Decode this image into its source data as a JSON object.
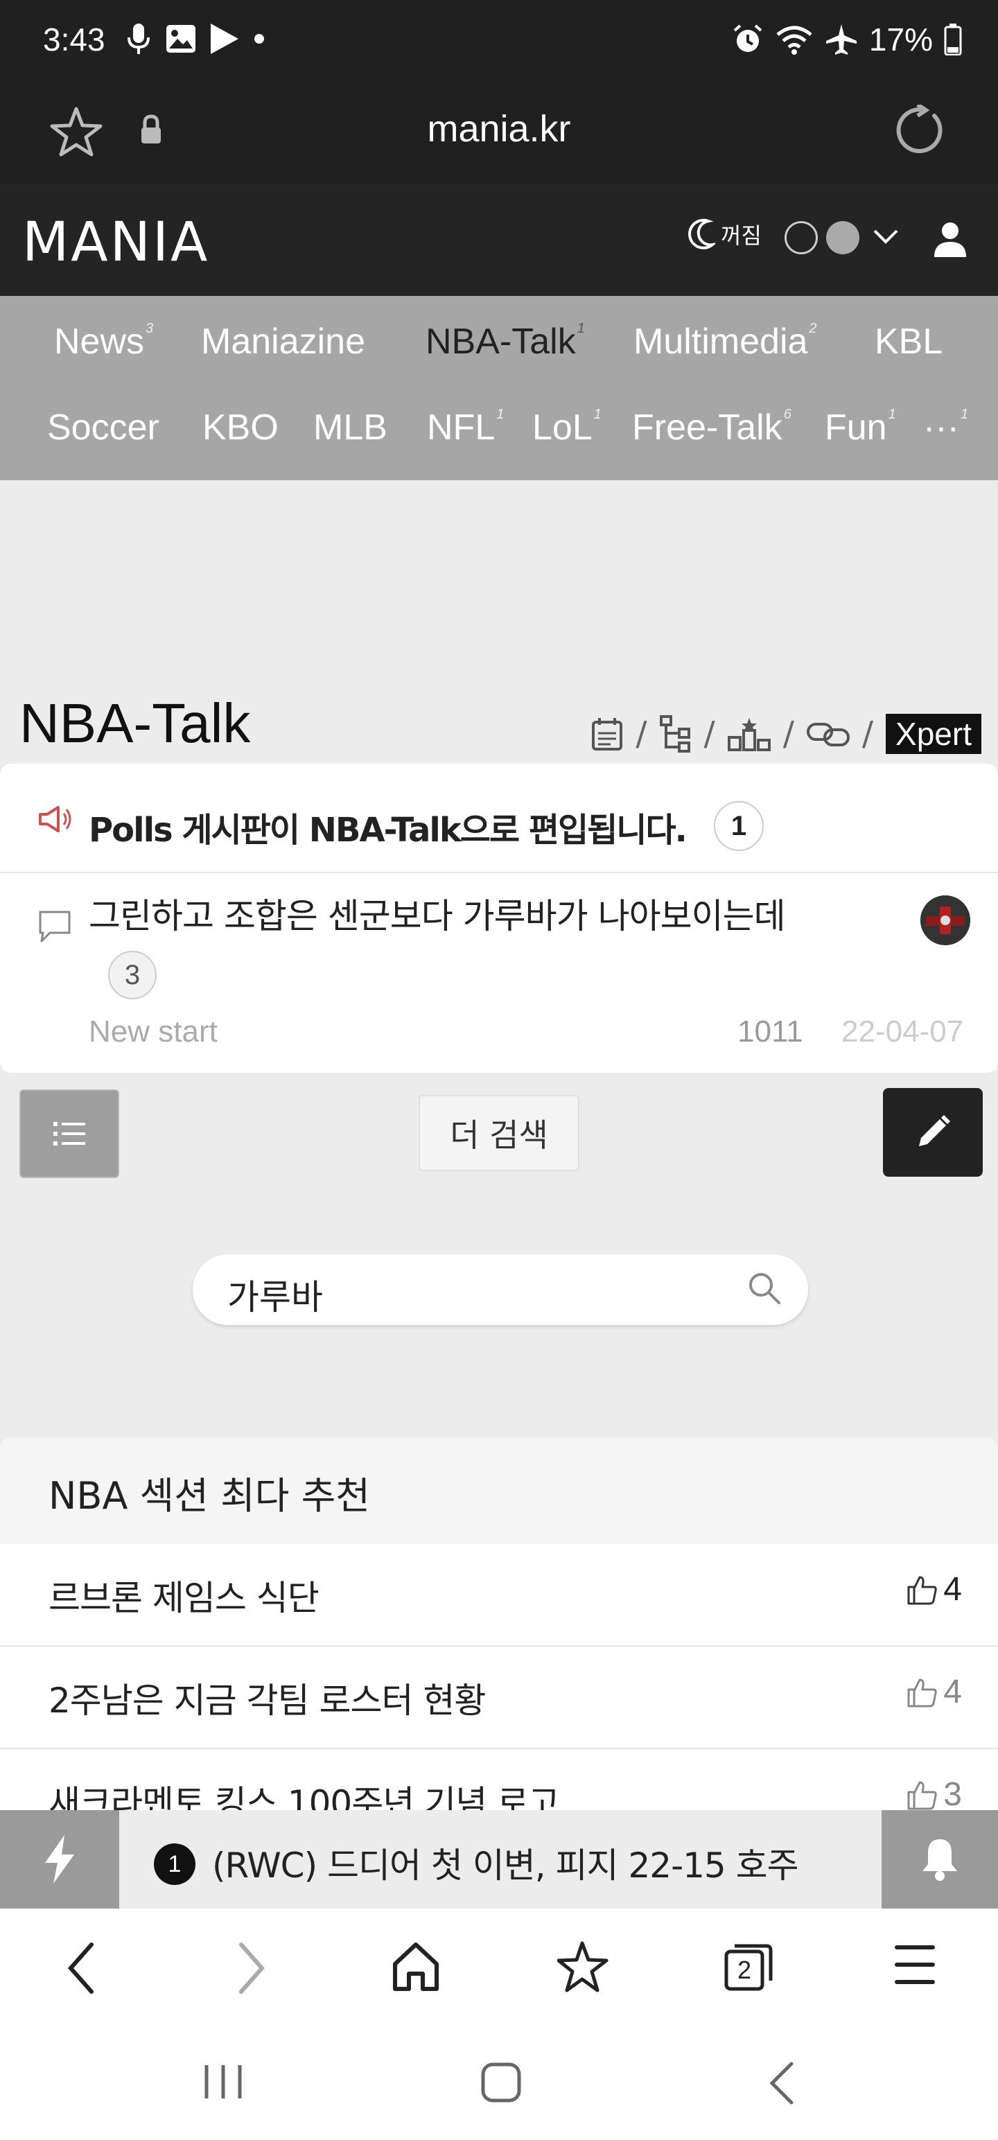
{
  "status_bar": {
    "time": "3:43",
    "battery": "17%"
  },
  "browser": {
    "url": "mania.kr",
    "tab_count": "2"
  },
  "site": {
    "logo": "MANIA",
    "dark_mode_label": "꺼짐"
  },
  "nav": {
    "items": [
      {
        "label": "News",
        "badge": "3"
      },
      {
        "label": "Maniazine",
        "badge": ""
      },
      {
        "label": "NBA-Talk",
        "badge": "1"
      },
      {
        "label": "Multimedia",
        "badge": "2"
      },
      {
        "label": "KBL",
        "badge": ""
      },
      {
        "label": "Soccer",
        "badge": ""
      },
      {
        "label": "KBO",
        "badge": ""
      },
      {
        "label": "MLB",
        "badge": ""
      },
      {
        "label": "NFL",
        "badge": "1"
      },
      {
        "label": "LoL",
        "badge": "1"
      },
      {
        "label": "Free-Talk",
        "badge": "6"
      },
      {
        "label": "Fun",
        "badge": "1"
      },
      {
        "label": "···",
        "badge": "1"
      }
    ]
  },
  "board": {
    "title": "NBA-Talk",
    "xpert_label": "Xpert"
  },
  "notice": {
    "text": "Polls 게시판이 NBA-Talk으로 편입됩니다.",
    "comment_count": "1"
  },
  "post": {
    "title": "그린하고 조합은 센군보다 가루바가 나아보이는데",
    "comment_count": "3",
    "author": "New start",
    "views": "1011",
    "date": "22-04-07"
  },
  "actions": {
    "more_search_label": "더 검색"
  },
  "search": {
    "value": "가루바"
  },
  "recommend": {
    "title": "NBA 섹션 최다 추천",
    "items": [
      {
        "text": "르브론 제임스 식단",
        "likes": "4"
      },
      {
        "text": "2주남은 지금 각팀 로스터 현황",
        "likes": "4"
      },
      {
        "text": "새크라멘토 킹스 100주년 기념 로고",
        "likes": "3"
      }
    ]
  },
  "ticker": {
    "rank": "1",
    "text": "(RWC) 드디어 첫 이변, 피지 22-15 호주"
  }
}
